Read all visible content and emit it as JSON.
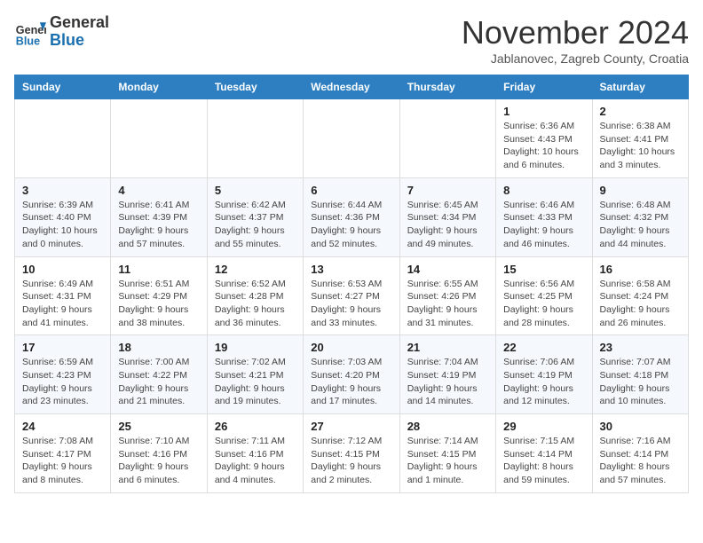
{
  "header": {
    "logo_general": "General",
    "logo_blue": "Blue",
    "month_title": "November 2024",
    "subtitle": "Jablanovec, Zagreb County, Croatia"
  },
  "weekdays": [
    "Sunday",
    "Monday",
    "Tuesday",
    "Wednesday",
    "Thursday",
    "Friday",
    "Saturday"
  ],
  "weeks": [
    [
      {
        "day": "",
        "info": ""
      },
      {
        "day": "",
        "info": ""
      },
      {
        "day": "",
        "info": ""
      },
      {
        "day": "",
        "info": ""
      },
      {
        "day": "",
        "info": ""
      },
      {
        "day": "1",
        "info": "Sunrise: 6:36 AM\nSunset: 4:43 PM\nDaylight: 10 hours and 6 minutes."
      },
      {
        "day": "2",
        "info": "Sunrise: 6:38 AM\nSunset: 4:41 PM\nDaylight: 10 hours and 3 minutes."
      }
    ],
    [
      {
        "day": "3",
        "info": "Sunrise: 6:39 AM\nSunset: 4:40 PM\nDaylight: 10 hours and 0 minutes."
      },
      {
        "day": "4",
        "info": "Sunrise: 6:41 AM\nSunset: 4:39 PM\nDaylight: 9 hours and 57 minutes."
      },
      {
        "day": "5",
        "info": "Sunrise: 6:42 AM\nSunset: 4:37 PM\nDaylight: 9 hours and 55 minutes."
      },
      {
        "day": "6",
        "info": "Sunrise: 6:44 AM\nSunset: 4:36 PM\nDaylight: 9 hours and 52 minutes."
      },
      {
        "day": "7",
        "info": "Sunrise: 6:45 AM\nSunset: 4:34 PM\nDaylight: 9 hours and 49 minutes."
      },
      {
        "day": "8",
        "info": "Sunrise: 6:46 AM\nSunset: 4:33 PM\nDaylight: 9 hours and 46 minutes."
      },
      {
        "day": "9",
        "info": "Sunrise: 6:48 AM\nSunset: 4:32 PM\nDaylight: 9 hours and 44 minutes."
      }
    ],
    [
      {
        "day": "10",
        "info": "Sunrise: 6:49 AM\nSunset: 4:31 PM\nDaylight: 9 hours and 41 minutes."
      },
      {
        "day": "11",
        "info": "Sunrise: 6:51 AM\nSunset: 4:29 PM\nDaylight: 9 hours and 38 minutes."
      },
      {
        "day": "12",
        "info": "Sunrise: 6:52 AM\nSunset: 4:28 PM\nDaylight: 9 hours and 36 minutes."
      },
      {
        "day": "13",
        "info": "Sunrise: 6:53 AM\nSunset: 4:27 PM\nDaylight: 9 hours and 33 minutes."
      },
      {
        "day": "14",
        "info": "Sunrise: 6:55 AM\nSunset: 4:26 PM\nDaylight: 9 hours and 31 minutes."
      },
      {
        "day": "15",
        "info": "Sunrise: 6:56 AM\nSunset: 4:25 PM\nDaylight: 9 hours and 28 minutes."
      },
      {
        "day": "16",
        "info": "Sunrise: 6:58 AM\nSunset: 4:24 PM\nDaylight: 9 hours and 26 minutes."
      }
    ],
    [
      {
        "day": "17",
        "info": "Sunrise: 6:59 AM\nSunset: 4:23 PM\nDaylight: 9 hours and 23 minutes."
      },
      {
        "day": "18",
        "info": "Sunrise: 7:00 AM\nSunset: 4:22 PM\nDaylight: 9 hours and 21 minutes."
      },
      {
        "day": "19",
        "info": "Sunrise: 7:02 AM\nSunset: 4:21 PM\nDaylight: 9 hours and 19 minutes."
      },
      {
        "day": "20",
        "info": "Sunrise: 7:03 AM\nSunset: 4:20 PM\nDaylight: 9 hours and 17 minutes."
      },
      {
        "day": "21",
        "info": "Sunrise: 7:04 AM\nSunset: 4:19 PM\nDaylight: 9 hours and 14 minutes."
      },
      {
        "day": "22",
        "info": "Sunrise: 7:06 AM\nSunset: 4:19 PM\nDaylight: 9 hours and 12 minutes."
      },
      {
        "day": "23",
        "info": "Sunrise: 7:07 AM\nSunset: 4:18 PM\nDaylight: 9 hours and 10 minutes."
      }
    ],
    [
      {
        "day": "24",
        "info": "Sunrise: 7:08 AM\nSunset: 4:17 PM\nDaylight: 9 hours and 8 minutes."
      },
      {
        "day": "25",
        "info": "Sunrise: 7:10 AM\nSunset: 4:16 PM\nDaylight: 9 hours and 6 minutes."
      },
      {
        "day": "26",
        "info": "Sunrise: 7:11 AM\nSunset: 4:16 PM\nDaylight: 9 hours and 4 minutes."
      },
      {
        "day": "27",
        "info": "Sunrise: 7:12 AM\nSunset: 4:15 PM\nDaylight: 9 hours and 2 minutes."
      },
      {
        "day": "28",
        "info": "Sunrise: 7:14 AM\nSunset: 4:15 PM\nDaylight: 9 hours and 1 minute."
      },
      {
        "day": "29",
        "info": "Sunrise: 7:15 AM\nSunset: 4:14 PM\nDaylight: 8 hours and 59 minutes."
      },
      {
        "day": "30",
        "info": "Sunrise: 7:16 AM\nSunset: 4:14 PM\nDaylight: 8 hours and 57 minutes."
      }
    ]
  ]
}
